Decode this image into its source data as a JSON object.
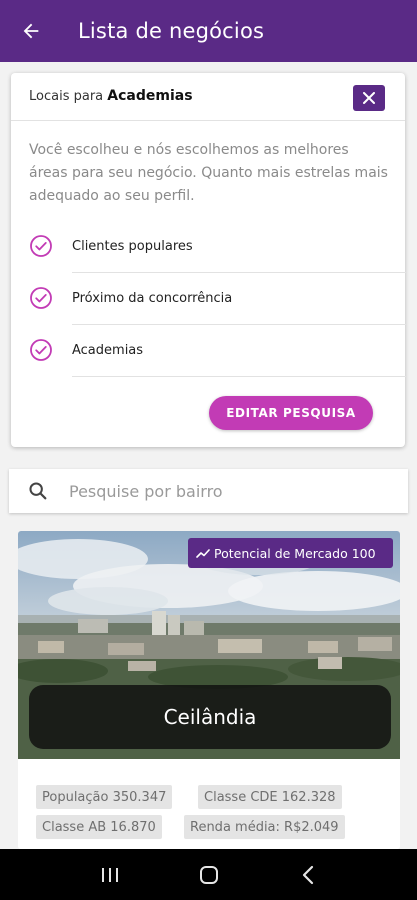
{
  "appbar": {
    "title": "Lista de negócios"
  },
  "summary": {
    "context_prefix": "Locais para",
    "context_category": "Academias",
    "description": "Você escolheu e nós escolhemos as melhores áreas para seu negócio. Quanto mais estrelas mais adequado ao seu perfil.",
    "criteria": [
      {
        "label": "Clientes populares"
      },
      {
        "label": "Próximo da concorrência"
      },
      {
        "label": "Academias"
      }
    ],
    "edit_label": "EDITAR PESQUISA"
  },
  "search": {
    "placeholder": "Pesquise por bairro",
    "value": ""
  },
  "place": {
    "badge": "Potencial de Mercado 100",
    "name": "Ceilândia",
    "stats": {
      "populacao": "População 350.347",
      "classe_cde": "Classe CDE 162.328",
      "classe_ab": "Classe AB 16.870",
      "renda": "Renda média: R$2.049"
    }
  },
  "colors": {
    "primary": "#5a2a86",
    "accent": "#c23bb5"
  },
  "icons": {
    "back": "arrow-left-icon",
    "close": "close-icon",
    "check": "check-circle-icon",
    "search": "search-icon",
    "trend": "trending-up-icon",
    "nav_recents": "recents-icon",
    "nav_home": "home-icon",
    "nav_back": "nav-back-icon"
  }
}
